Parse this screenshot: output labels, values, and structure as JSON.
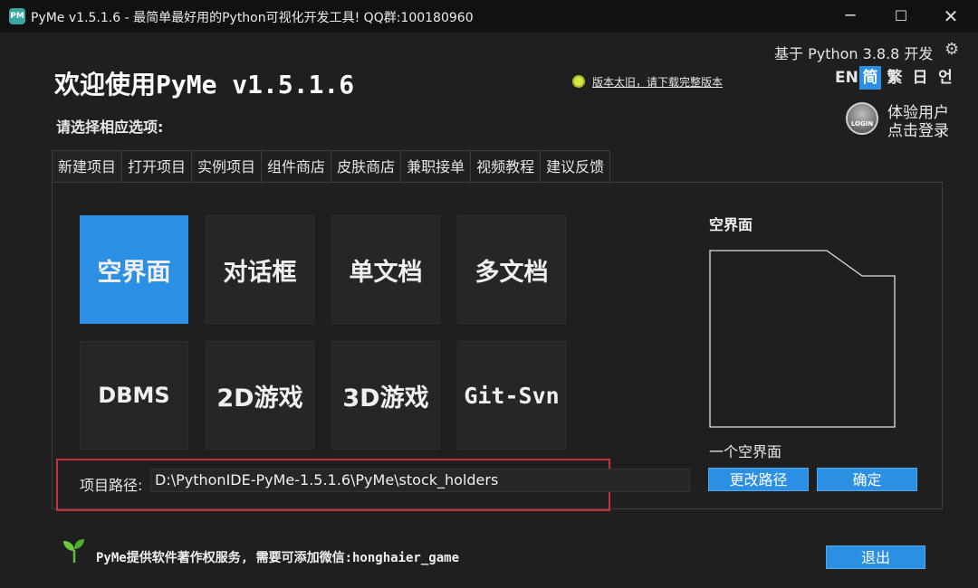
{
  "window": {
    "title": "PyMe v1.5.1.6 - 最简单最好用的Python可视化开发工具! QQ群:100180960",
    "app_icon": "pyme-logo-icon",
    "controls": {
      "minimize": "─",
      "maximize": "☐",
      "close": "✕"
    }
  },
  "header": {
    "python_version": "基于 Python 3.8.8 开发",
    "settings_icon": "gear-icon",
    "languages": [
      "EN",
      "简",
      "繁",
      "日",
      "언"
    ],
    "active_language": "简",
    "welcome": "欢迎使用PyMe v1.5.1.6",
    "notice_link": "版本太旧，请下载完整版本",
    "select_prompt": "请选择相应选项:",
    "user": {
      "name": "体验用户",
      "login": "点击登录",
      "avatar_text": "LOGIN"
    }
  },
  "tabs": [
    "新建项目",
    "打开项目",
    "实例项目",
    "组件商店",
    "皮肤商店",
    "兼职接单",
    "视频教程",
    "建议反馈"
  ],
  "active_tab": "新建项目",
  "templates": [
    "空界面",
    "对话框",
    "单文档",
    "多文档",
    "DBMS",
    "2D游戏",
    "3D游戏",
    "Git-Svn"
  ],
  "selected_template": "空界面",
  "preview": {
    "title": "空界面",
    "description": "一个空界面"
  },
  "path": {
    "label": "项目路径:",
    "value": "D:\\PythonIDE-PyMe-1.5.1.6\\PyMe\\stock_holders"
  },
  "buttons": {
    "change_path": "更改路径",
    "confirm": "确定",
    "exit": "退出"
  },
  "footer": {
    "text": "PyMe提供软件著作权服务, 需要可添加微信:honghaier_game"
  },
  "colors": {
    "accent": "#2b8fe3",
    "background": "#1f1f1f",
    "titlebar": "#111111",
    "highlight_border": "#c8313a"
  }
}
